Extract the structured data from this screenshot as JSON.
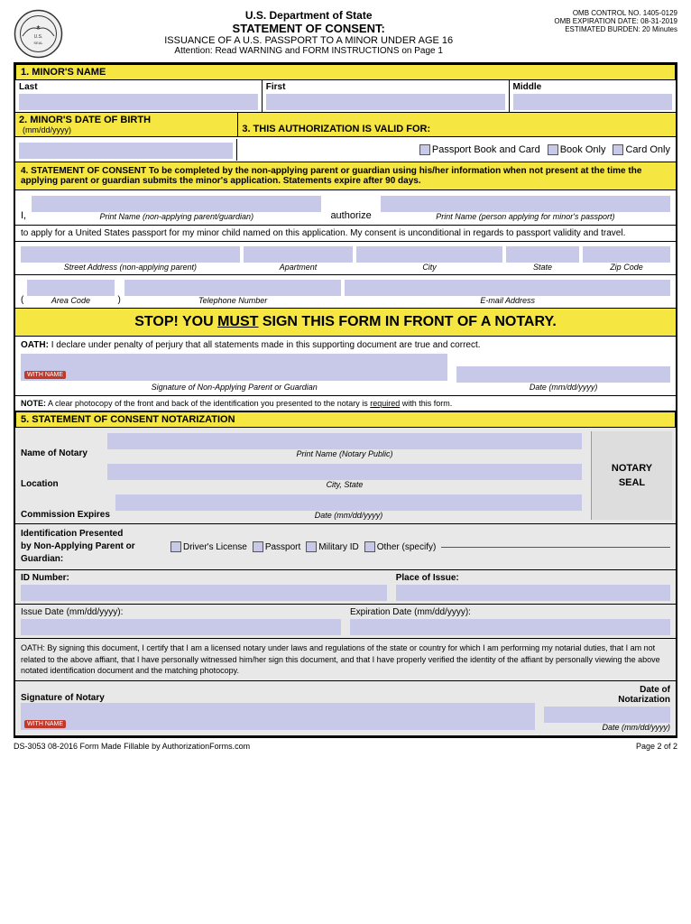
{
  "header": {
    "dept": "U.S. Department of State",
    "title": "STATEMENT OF CONSENT:",
    "subtitle": "ISSUANCE OF A U.S. PASSPORT TO A MINOR UNDER AGE 16",
    "attention": "Attention: Read WARNING and FORM INSTRUCTIONS on Page 1",
    "omb_line1": "OMB CONTROL NO. 1405-0129",
    "omb_line2": "OMB EXPIRATION DATE: 08-31-2019",
    "omb_line3": "ESTIMATED BURDEN: 20 Minutes"
  },
  "sections": {
    "s1": {
      "label": "1. MINOR'S NAME"
    },
    "s2": {
      "label": "2. MINOR'S DATE OF BIRTH"
    },
    "s3": {
      "label": "3. THIS AUTHORIZATION IS VALID FOR:"
    },
    "s4": {
      "label": "4. STATEMENT OF CONSENT"
    },
    "s5": {
      "label": "5. STATEMENT OF CONSENT NOTARIZATION"
    }
  },
  "fields": {
    "last": "Last",
    "first": "First",
    "middle": "Middle",
    "dob_format": "(mm/dd/yyyy)",
    "passport_book_card": "Passport Book and Card",
    "book_only": "Book Only",
    "card_only": "Card Only",
    "s4_text": "To be completed by the non-applying parent or guardian using his/her information when not present at the time the applying parent or guardian submits the minor's application.",
    "s4_expire": "Statements expire after 90 days.",
    "i_text": "I,",
    "authorize_text": "authorize",
    "print_name_non": "Print Name (non-applying parent/guardian)",
    "print_name_apply": "Print Name (person applying for minor's passport)",
    "apply_text": "to apply for a United States passport for my minor child named on this application. My consent is unconditional in regards to passport validity and travel.",
    "street_label": "Street Address (non-applying parent)",
    "apartment_label": "Apartment",
    "city_label": "City",
    "state_label": "State",
    "zip_label": "Zip Code",
    "area_code_label": "Area Code",
    "telephone_label": "Telephone Number",
    "email_label": "E-mail Address",
    "stop_text": "STOP! YOU MUST SIGN THIS FORM IN FRONT OF A NOTARY.",
    "oath_label": "OATH:",
    "oath_text": "I declare under penalty of perjury that all statements made in this supporting document are true and correct.",
    "sig_non_label": "Signature of Non-Applying Parent or Guardian",
    "date_label": "Date (mm/dd/yyyy)",
    "note_label": "NOTE:",
    "note_text": "A clear photocopy of the front and back of the identification you presented to the notary is required with this form.",
    "notary_name_label": "Name of Notary",
    "print_name_notary": "Print Name (Notary Public)",
    "location_label": "Location",
    "city_state_label": "City, State",
    "commission_label": "Commission Expires",
    "date_format": "Date (mm/dd/yyyy)",
    "notary_seal": "NOTARY\nSEAL",
    "id_label": "Identification Presented\nby Non-Applying Parent or\nGuardian:",
    "drivers_license": "Driver's License",
    "passport": "Passport",
    "military_id": "Military ID",
    "other": "Other (specify)",
    "id_number_label": "ID Number:",
    "place_of_issue_label": "Place of Issue:",
    "issue_date_label": "Issue Date (mm/dd/yyyy):",
    "expiration_date_label": "Expiration Date (mm/dd/yyyy):",
    "oath_bottom": "OATH: By signing this document, I certify that I am a licensed notary under laws and regulations of the state or country for which I am performing my notarial duties, that I am not related to the above affiant, that I have personally witnessed him/her sign this document, and that I have properly verified the identity of the affiant by personally viewing the above notated identification document and the matching photocopy.",
    "sig_notary_label": "Signature of Notary",
    "date_of_notarization": "Date of\nNotarization",
    "with_name": "WITH NAME",
    "footer_form": "DS-3053  08-2016  Form Made Fillable by AuthorizationForms.com",
    "footer_page": "Page 2 of 2"
  }
}
